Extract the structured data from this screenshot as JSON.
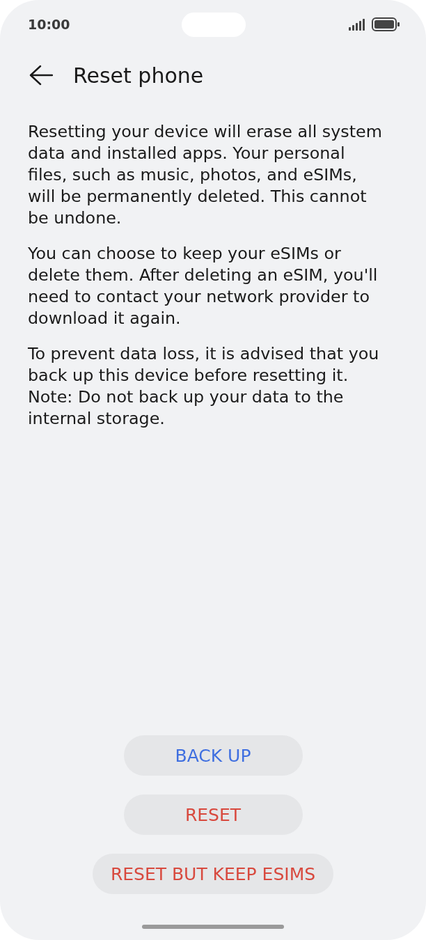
{
  "status_bar": {
    "time": "10:00"
  },
  "header": {
    "title": "Reset phone"
  },
  "paragraphs": [
    "Resetting your device will erase all system data and installed apps. Your personal files, such as music, photos, and eSIMs, will be permanently deleted. This cannot be undone.",
    "You can choose to keep your eSIMs or delete them. After deleting an eSIM, you'll need to contact your network provider to download it again.",
    "To prevent data loss, it is advised that you back up this device before resetting it. Note: Do not back up your data to the internal storage."
  ],
  "buttons": [
    {
      "label": "BACK UP",
      "kind": "normal"
    },
    {
      "label": "RESET",
      "kind": "destructive"
    },
    {
      "label": "RESET BUT KEEP ESIMS",
      "kind": "destructive"
    }
  ]
}
